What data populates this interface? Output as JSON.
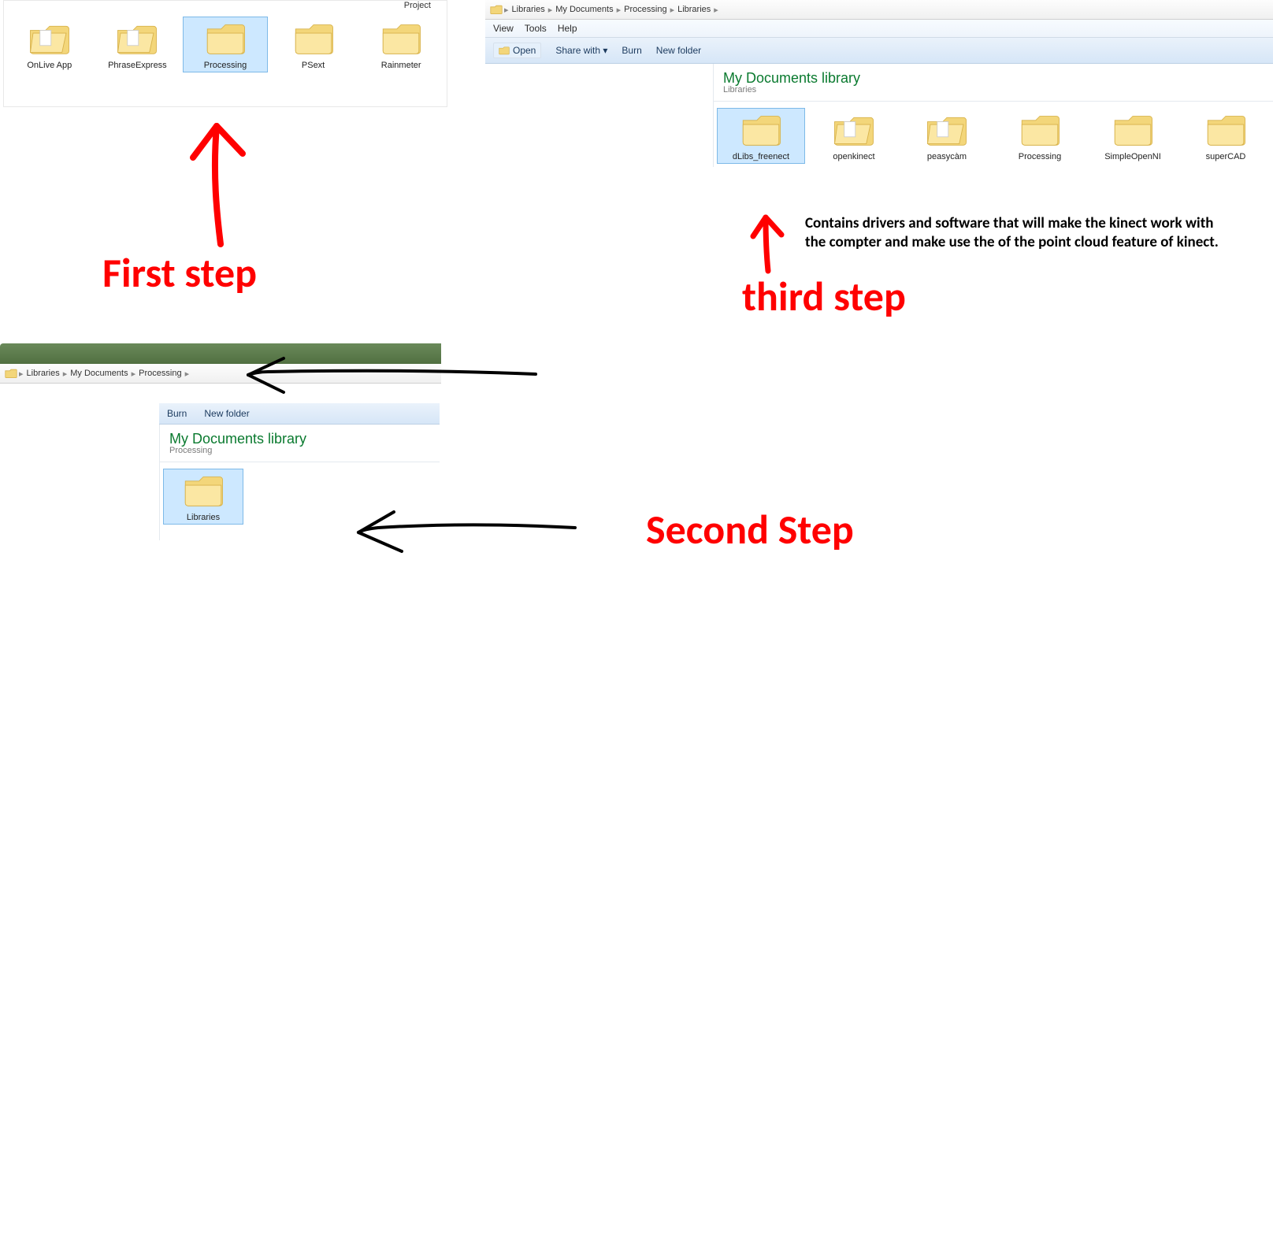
{
  "step1": {
    "topLabel": "Project",
    "folders": [
      {
        "label": "OnLive App",
        "selected": false,
        "open": true
      },
      {
        "label": "PhraseExpress",
        "selected": false,
        "open": true
      },
      {
        "label": "Processing",
        "selected": true,
        "open": false
      },
      {
        "label": "PSext",
        "selected": false,
        "open": false
      },
      {
        "label": "Rainmeter",
        "selected": false,
        "open": false
      }
    ]
  },
  "step1_annotation": "First step",
  "step2": {
    "breadcrumb": [
      "Libraries",
      "My Documents",
      "Processing"
    ],
    "toolbar": {
      "burn": "Burn",
      "newfolder": "New folder"
    },
    "library_title": "My Documents library",
    "library_sub": "Processing",
    "folder": {
      "label": "Libraries",
      "selected": true
    }
  },
  "step2_annotation": "Second Step",
  "step3": {
    "breadcrumb": [
      "Libraries",
      "My Documents",
      "Processing",
      "Libraries"
    ],
    "menubar": [
      "View",
      "Tools",
      "Help"
    ],
    "toolbar": {
      "open": "Open",
      "share": "Share with ▾",
      "burn": "Burn",
      "newfolder": "New folder"
    },
    "library_title": "My Documents library",
    "library_sub": "Libraries",
    "folders": [
      {
        "label": "dLibs_freenect",
        "selected": true,
        "open": false
      },
      {
        "label": "openkinect",
        "selected": false,
        "open": true
      },
      {
        "label": "peasycàm",
        "selected": false,
        "open": true
      },
      {
        "label": "Processing",
        "selected": false,
        "open": false
      },
      {
        "label": "SimpleOpenNI",
        "selected": false,
        "open": false
      },
      {
        "label": "superCAD",
        "selected": false,
        "open": false
      }
    ],
    "description": "Contains drivers and software that will make the kinect work with the compter and make use the of the point cloud feature of kinect."
  },
  "step3_annotation": "third step"
}
